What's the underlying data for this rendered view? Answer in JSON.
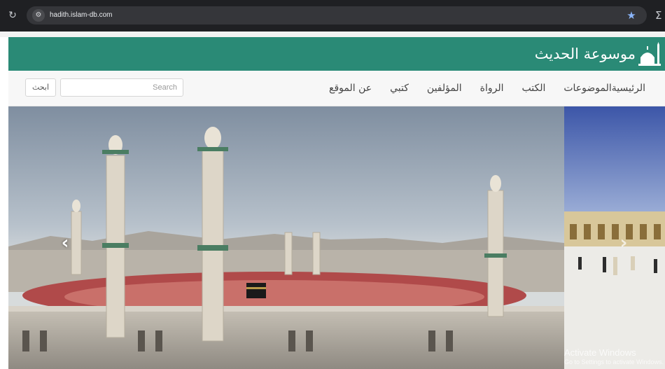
{
  "browser": {
    "url": "hadith.islam-db.com",
    "reload_icon": "reload-icon",
    "site_info_icon": "site-info-icon",
    "star_icon": "bookmark-star-icon"
  },
  "site": {
    "logo_text": "موسوعة الحديث",
    "header_color": "#2a8a76"
  },
  "nav": {
    "items": [
      "الرئيسية",
      "الموضوعات",
      "الكتب",
      "الرواة",
      "المؤلفين",
      "كتبي",
      "عن الموقع"
    ]
  },
  "search": {
    "placeholder": "Search",
    "button_label": "ابحث"
  },
  "carousel": {
    "prev_icon": "chevron-left-icon",
    "next_icon": "chevron-right-icon"
  },
  "watermark": {
    "title": "Activate Windows",
    "subtitle": "Go to Settings to activate Windows."
  }
}
